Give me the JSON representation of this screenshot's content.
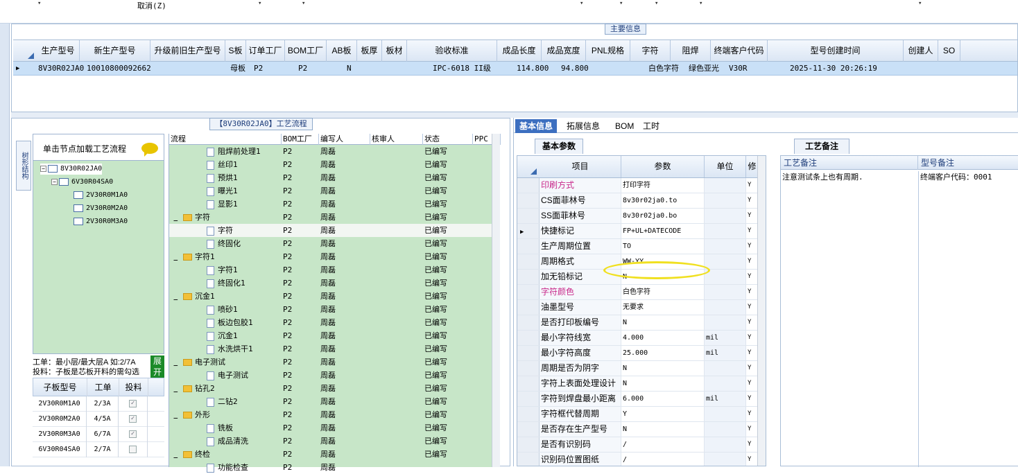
{
  "toolbar": {
    "cancel_label": "取消(Z)",
    "dropdown_arrow": "▾"
  },
  "main": {
    "title": "主要信息",
    "columns": [
      "生产型号",
      "新生产型号",
      "升级前旧生产型号",
      "S板",
      "订单工厂",
      "BOM工厂",
      "AB板",
      "板厚",
      "板材",
      "验收标准",
      "成品长度",
      "成品宽度",
      "PNL规格",
      "字符",
      "阻焊",
      "终端客户代码",
      "型号创建时间",
      "创建人",
      "SO"
    ],
    "row": {
      "prod_model": "8V30R02JA0",
      "new_model": "10010800092662",
      "s_board": "母板",
      "order_factory": "P2",
      "bom_factory": "P2",
      "ab_board": "N",
      "standard": "IPC-6018 II级",
      "length": "114.800",
      "width": "94.800",
      "char": "白色字符",
      "solder": "绿色亚光",
      "customer": "V30R",
      "created": "2025-11-30 20:26:19",
      "indicator": "▶"
    }
  },
  "flow": {
    "title": "【8V30R02JA0】工艺流程",
    "vtab_label": "树形结构",
    "tree_header": "单击节点加载工艺流程",
    "tree": [
      {
        "label": "8V30R02JA0"
      },
      {
        "label": "6V30R04SA0"
      },
      {
        "label": "2V30R0M1A0"
      },
      {
        "label": "2V30R0M2A0"
      },
      {
        "label": "2V30R0M3A0"
      }
    ],
    "note_line1": "工单：最小层/最大层A 如:2/7A",
    "note_line2": "投料：子板是芯板开料的需勾选",
    "expand_label": "展开",
    "sub_headers": [
      "子板型号",
      "工单",
      "投料"
    ],
    "sub_rows": [
      {
        "model": "2V30R0M1A0",
        "order": "2/3A",
        "feed": "✓"
      },
      {
        "model": "2V30R0M2A0",
        "order": "4/5A",
        "feed": "✓"
      },
      {
        "model": "2V30R0M3A0",
        "order": "6/7A",
        "feed": "✓"
      },
      {
        "model": "6V30R04SA0",
        "order": "2/7A",
        "feed": ""
      }
    ],
    "proc_headers": [
      "流程",
      "BOM工厂",
      "编写人",
      "核审人",
      "状态",
      "PPC"
    ],
    "proc_rows": [
      {
        "name": "阻焊前处理1",
        "type": "doc",
        "bom": "P2",
        "author": "周磊",
        "status": "已编写"
      },
      {
        "name": "丝印1",
        "type": "doc",
        "bom": "P2",
        "author": "周磊",
        "status": "已编写"
      },
      {
        "name": "预烘1",
        "type": "doc",
        "bom": "P2",
        "author": "周磊",
        "status": "已编写"
      },
      {
        "name": "曝光1",
        "type": "doc",
        "bom": "P2",
        "author": "周磊",
        "status": "已编写"
      },
      {
        "name": "显影1",
        "type": "doc",
        "bom": "P2",
        "author": "周磊",
        "status": "已编写"
      },
      {
        "name": "字符",
        "type": "folder",
        "bom": "P2",
        "author": "周磊",
        "status": "已编写"
      },
      {
        "name": "字符",
        "type": "doc",
        "bom": "P2",
        "author": "周磊",
        "status": "已编写"
      },
      {
        "name": "终固化",
        "type": "doc",
        "bom": "P2",
        "author": "周磊",
        "status": "已编写"
      },
      {
        "name": "字符1",
        "type": "folder",
        "bom": "P2",
        "author": "周磊",
        "status": "已编写"
      },
      {
        "name": "字符1",
        "type": "doc",
        "bom": "P2",
        "author": "周磊",
        "status": "已编写"
      },
      {
        "name": "终固化1",
        "type": "doc",
        "bom": "P2",
        "author": "周磊",
        "status": "已编写"
      },
      {
        "name": "沉金1",
        "type": "folder",
        "bom": "P2",
        "author": "周磊",
        "status": "已编写"
      },
      {
        "name": "喷砂1",
        "type": "doc",
        "bom": "P2",
        "author": "周磊",
        "status": "已编写"
      },
      {
        "name": "板边包胶1",
        "type": "doc",
        "bom": "P2",
        "author": "周磊",
        "status": "已编写"
      },
      {
        "name": "沉金1",
        "type": "doc",
        "bom": "P2",
        "author": "周磊",
        "status": "已编写"
      },
      {
        "name": "水洗烘干1",
        "type": "doc",
        "bom": "P2",
        "author": "周磊",
        "status": "已编写"
      },
      {
        "name": "电子测试",
        "type": "folder",
        "bom": "P2",
        "author": "周磊",
        "status": "已编写"
      },
      {
        "name": "电子测试",
        "type": "doc",
        "bom": "P2",
        "author": "周磊",
        "status": "已编写"
      },
      {
        "name": "钻孔2",
        "type": "folder",
        "bom": "P2",
        "author": "周磊",
        "status": "已编写"
      },
      {
        "name": "二钻2",
        "type": "doc",
        "bom": "P2",
        "author": "周磊",
        "status": "已编写"
      },
      {
        "name": "外形",
        "type": "folder",
        "bom": "P2",
        "author": "周磊",
        "status": "已编写"
      },
      {
        "name": "铣板",
        "type": "doc",
        "bom": "P2",
        "author": "周磊",
        "status": "已编写"
      },
      {
        "name": "成品清洗",
        "type": "doc",
        "bom": "P2",
        "author": "周磊",
        "status": "已编写"
      },
      {
        "name": "终检",
        "type": "folder",
        "bom": "P2",
        "author": "周磊",
        "status": "已编写"
      },
      {
        "name": "功能检查",
        "type": "doc",
        "bom": "P2",
        "author": "周磊",
        "status": ""
      }
    ]
  },
  "right": {
    "tabs": [
      "基本信息",
      "拓展信息",
      "BOM",
      "工时"
    ],
    "sub_basic": "基本参数",
    "sub_notes": "工艺备注",
    "param_headers": [
      "项目",
      "参数",
      "单位",
      "修"
    ],
    "params": [
      {
        "item": "印刷方式",
        "value": "打印字符",
        "unit": "",
        "flag": "Y",
        "pink": true
      },
      {
        "item": "CS面菲林号",
        "value": "8v30r02ja0.to",
        "unit": "",
        "flag": "Y"
      },
      {
        "item": "SS面菲林号",
        "value": "8v30r02ja0.bo",
        "unit": "",
        "flag": "Y"
      },
      {
        "item": "快捷标记",
        "value": "FP+UL+DATECODE",
        "unit": "",
        "flag": "Y",
        "current": true
      },
      {
        "item": "生产周期位置",
        "value": "TO",
        "unit": "",
        "flag": "Y"
      },
      {
        "item": "周期格式",
        "value": "WW-YY",
        "unit": "",
        "flag": "Y"
      },
      {
        "item": "加无铅标记",
        "value": "N",
        "unit": "",
        "flag": "Y"
      },
      {
        "item": "字符颜色",
        "value": "白色字符",
        "unit": "",
        "flag": "Y",
        "pink": true
      },
      {
        "item": "油墨型号",
        "value": "无要求",
        "unit": "",
        "flag": "Y"
      },
      {
        "item": "是否打印板编号",
        "value": "N",
        "unit": "",
        "flag": "Y"
      },
      {
        "item": "最小字符线宽",
        "value": "4.000",
        "unit": "mil",
        "flag": "Y"
      },
      {
        "item": "最小字符高度",
        "value": "25.000",
        "unit": "mil",
        "flag": "Y"
      },
      {
        "item": "周期是否为阴字",
        "value": "N",
        "unit": "",
        "flag": "Y"
      },
      {
        "item": "字符上表面处理设计",
        "value": "N",
        "unit": "",
        "flag": "Y"
      },
      {
        "item": "字符到焊盘最小距离",
        "value": "6.000",
        "unit": "mil",
        "flag": "Y"
      },
      {
        "item": "字符框代替周期",
        "value": "Y",
        "unit": "",
        "flag": "Y"
      },
      {
        "item": "是否存在生产型号",
        "value": "N",
        "unit": "",
        "flag": "Y"
      },
      {
        "item": "是否有识别码",
        "value": "/",
        "unit": "",
        "flag": "Y"
      },
      {
        "item": "识别码位置图纸",
        "value": "/",
        "unit": "",
        "flag": "Y"
      }
    ],
    "notes_headers": [
      "工艺备注",
      "型号备注"
    ],
    "process_note": "注意测试条上也有周期.",
    "model_note": "终端客户代码：0001"
  }
}
